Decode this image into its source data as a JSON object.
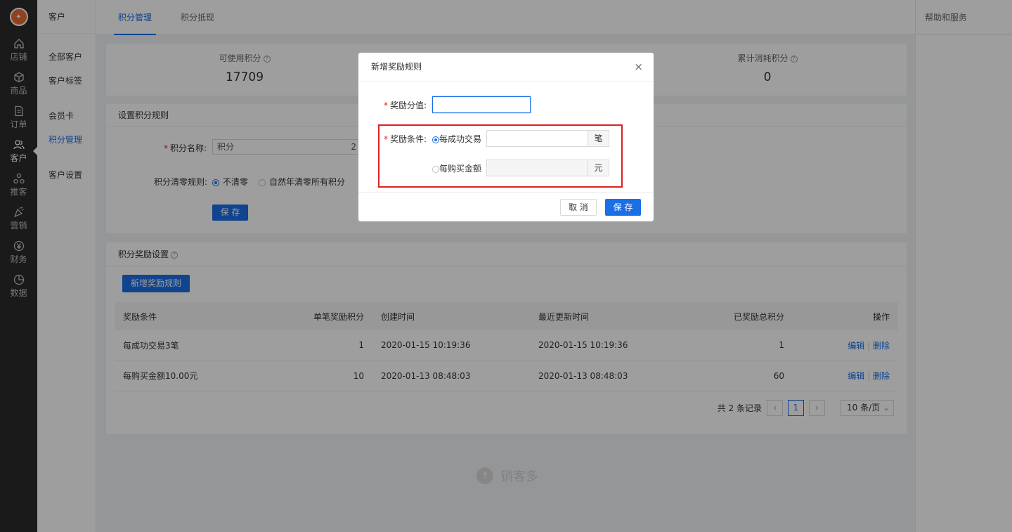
{
  "nav": {
    "items": [
      {
        "label": "店铺",
        "icon": "home-icon"
      },
      {
        "label": "商品",
        "icon": "box-icon"
      },
      {
        "label": "订单",
        "icon": "document-icon"
      },
      {
        "label": "客户",
        "icon": "users-icon"
      },
      {
        "label": "推客",
        "icon": "share-icon"
      },
      {
        "label": "营销",
        "icon": "party-icon"
      },
      {
        "label": "财务",
        "icon": "yen-icon"
      },
      {
        "label": "数据",
        "icon": "pie-chart-icon"
      }
    ]
  },
  "submenu": {
    "head": "客户",
    "items": [
      "全部客户",
      "客户标签",
      "会员卡",
      "积分管理",
      "客户设置"
    ]
  },
  "tabs": [
    "积分管理",
    "积分抵现"
  ],
  "help": "帮助和服务",
  "stats": {
    "available_label": "可使用积分",
    "available_value": "17709",
    "consumed_label": "累计消耗积分",
    "consumed_value": "0"
  },
  "rules": {
    "title": "设置积分规则",
    "name_label": "积分名称:",
    "name_value": "积分",
    "name_suffix": "2",
    "clear_label": "积分清零规则:",
    "clear_opt1": "不清零",
    "clear_opt2": "自然年清零所有积分",
    "save": "保 存"
  },
  "reward": {
    "title": "积分奖励设置",
    "add_button": "新增奖励规则",
    "columns": [
      "奖励条件",
      "单笔奖励积分",
      "创建时间",
      "最近更新时间",
      "已奖励总积分",
      "操作"
    ],
    "rows": [
      {
        "cond": "每成功交易3笔",
        "points": "1",
        "created": "2020-01-15 10:19:36",
        "updated": "2020-01-15 10:19:36",
        "total": "1",
        "edit": "编辑",
        "delete": "删除"
      },
      {
        "cond": "每购买金额10.00元",
        "points": "10",
        "created": "2020-01-13 08:48:03",
        "updated": "2020-01-13 08:48:03",
        "total": "60",
        "edit": "编辑",
        "delete": "删除"
      }
    ],
    "pager": {
      "total": "共 2 条记录",
      "prev": "‹",
      "page": "1",
      "next": "›",
      "size": "10 条/页"
    }
  },
  "watermark": "销客多",
  "modal": {
    "title": "新增奖励规则",
    "close": "×",
    "points_label": "奖励分值:",
    "points_value": "",
    "cond_label": "奖励条件:",
    "opt_trade": "每成功交易",
    "trade_unit": "笔",
    "opt_amount": "每购买金额",
    "amount_unit": "元",
    "cancel": "取 消",
    "save": "保 存"
  },
  "colors": {
    "accent": "#1a6ee6",
    "highlight": "#e02020",
    "sidebar": "#2b2b2b"
  }
}
